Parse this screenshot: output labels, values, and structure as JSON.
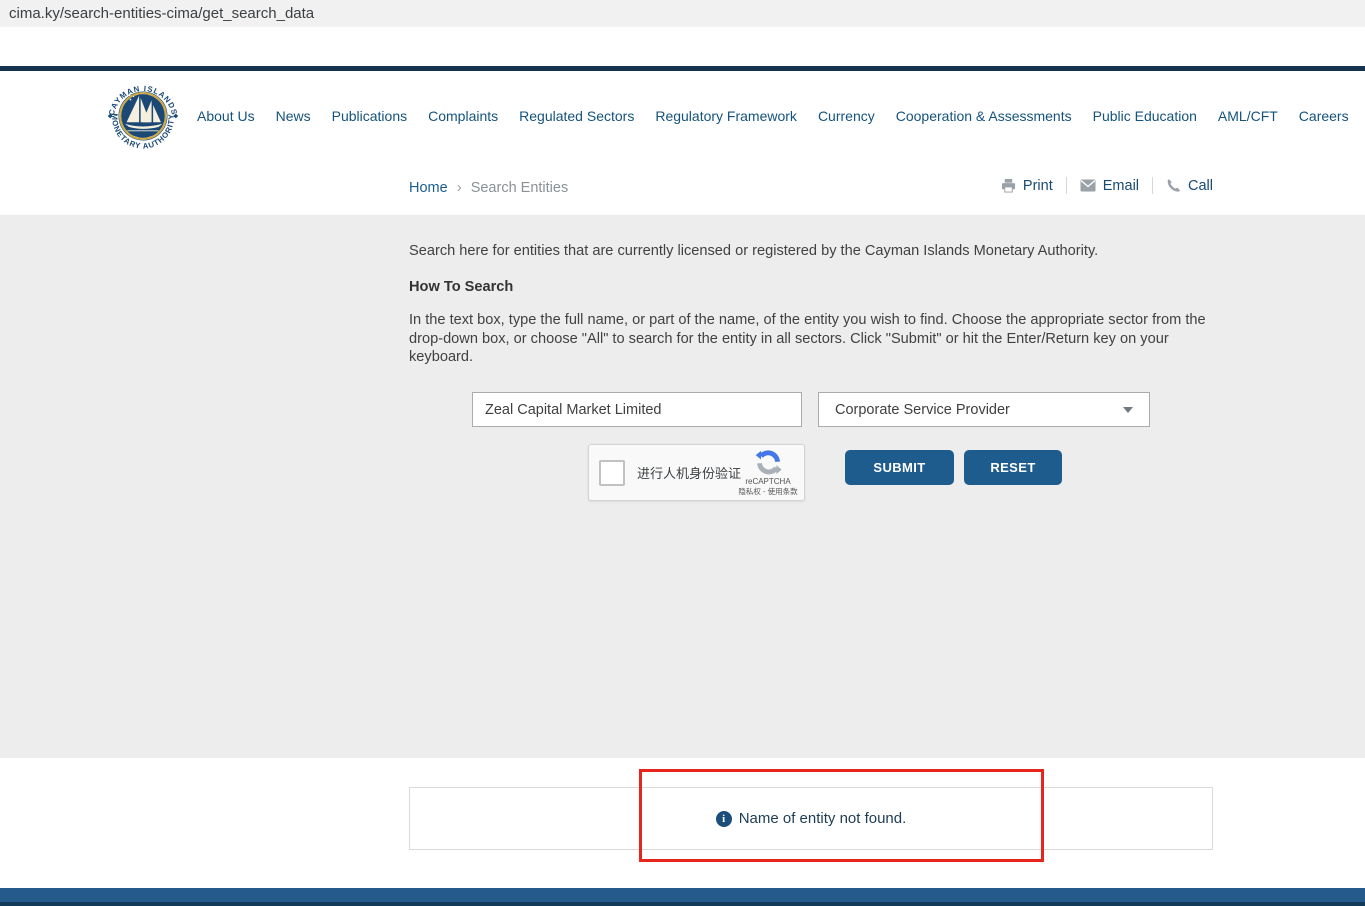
{
  "browser": {
    "url": "cima.ky/search-entities-cima/get_search_data"
  },
  "logo": {
    "arc_top": "CAYMAN ISLANDS",
    "arc_bottom": "MONETARY AUTHORITY"
  },
  "nav": {
    "items": [
      "About Us",
      "News",
      "Publications",
      "Complaints",
      "Regulated Sectors",
      "Regulatory Framework",
      "Currency",
      "Cooperation & Assessments",
      "Public Education",
      "AML/CFT",
      "Careers"
    ]
  },
  "breadcrumb": {
    "home": "Home",
    "separator": "›",
    "current": "Search Entities"
  },
  "actions": {
    "print": "Print",
    "email": "Email",
    "call": "Call"
  },
  "content": {
    "intro": "Search here for entities that are currently licensed or registered by the Cayman Islands Monetary Authority.",
    "how_to_title": "How To Search",
    "how_to_body": "In the text box, type the full name, or part of the name, of the entity you wish to find. Choose the appropriate sector from the drop-down box, or choose \"All\" to search for the entity in all sectors. Click \"Submit\" or hit the Enter/Return key on your keyboard."
  },
  "form": {
    "entity_input_value": "Zeal Capital Market Limited",
    "sector_selected": "Corporate Service Provider",
    "submit": "SUBMIT",
    "reset": "RESET"
  },
  "recaptcha": {
    "checkbox_label": "进行人机身份验证",
    "brand": "reCAPTCHA",
    "legal": "隐私权 - 使用条款"
  },
  "results": {
    "not_found_message": "Name of entity not found.",
    "info_icon": "i"
  },
  "colors": {
    "accent_blue": "#1e5c8d",
    "navy_bar": "#16334e",
    "footer_blue": "#245a8c",
    "link_blue": "#1b5d8f",
    "highlight_red": "#e6251c",
    "page_grey": "#ededee"
  }
}
